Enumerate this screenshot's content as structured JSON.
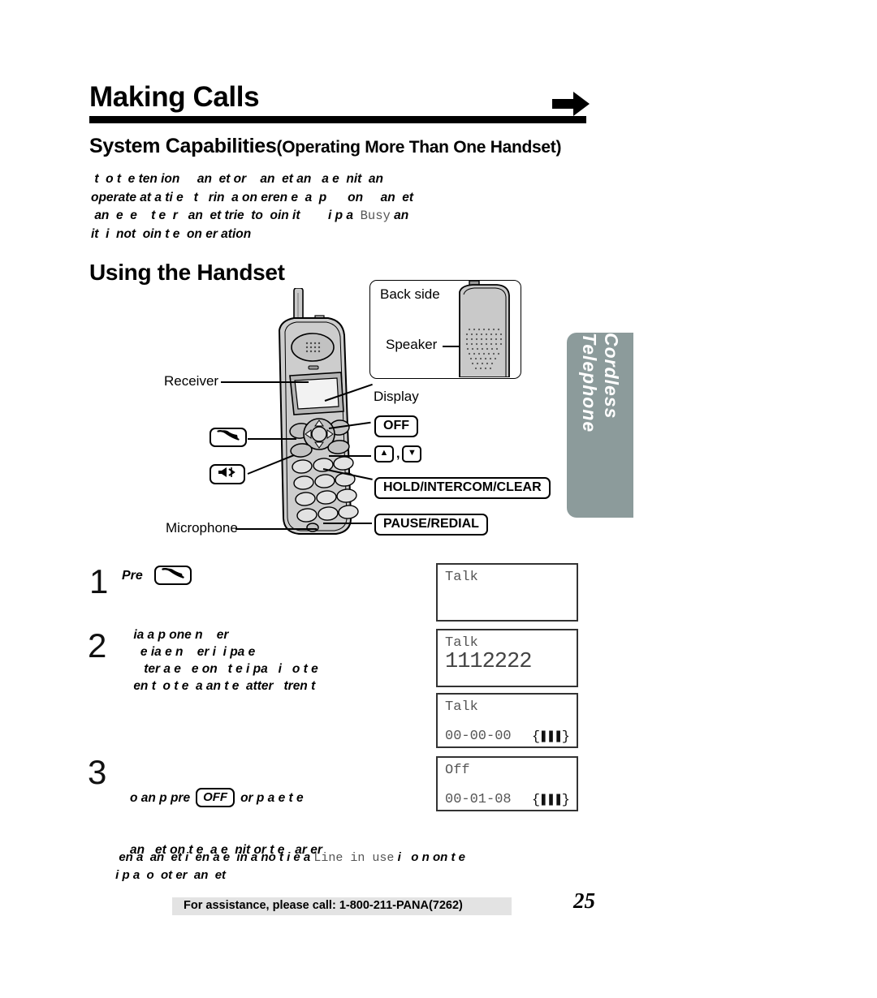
{
  "document": {
    "page_number": "25",
    "title": "Making Calls",
    "section_heading_main": "System Capabilities",
    "section_heading_sub": "(Operating More Than One Handset)",
    "intro_paragraph": " t  o t  e ten ion     an  et or    an  et an   a e  nit  an\noperate at a ti e   t   rin  a on eren e  a  p      on     an  et\n an  e  e    t e  r   an  et trie  to  oin it        i p a  ",
    "intro_mono_word": "Busy",
    "intro_paragraph_tail": " an\nit  i  not  oin t e  on er ation",
    "subsection_heading": "Using the Handset"
  },
  "diagram": {
    "backside_box_label": "Back side",
    "speaker_label": "Speaker",
    "receiver_label": "Receiver",
    "display_label": "Display",
    "microphone_label": "Microphone",
    "callouts": {
      "off_key": "OFF",
      "up_key": "▲",
      "down_key": "▼",
      "arrow_separator": ",",
      "hold_key": "HOLD/INTERCOM/CLEAR",
      "pause_key": "PAUSE/REDIAL",
      "talk_key_icon": "handset-icon",
      "speakerphone_key_icon": "speakerphone-icon"
    }
  },
  "side_tab": {
    "label": "Cordless Telephone",
    "color": "#8c9b9b"
  },
  "steps": [
    {
      "number": "1",
      "text": "Pre",
      "key_icon": "handset-icon"
    },
    {
      "number": "2",
      "text": " ia a p one n    er\n   e ia e n    er i  i pa e\n    ter a e   e on   t e i pa   i   o t e\n en t  o t e  a an t e  atter   tren t"
    },
    {
      "number": "3",
      "text_before_key": " o  an   p pre",
      "key_label": "OFF",
      "text_after_key": "or p a  e t e",
      "text_line2": "an   et on t e  a e  nit or t e   ar er"
    }
  ],
  "lcd_displays": [
    {
      "line1": "Talk",
      "line2": "",
      "big_number": "",
      "time": "",
      "battery": ""
    },
    {
      "line1": "Talk",
      "line2": "",
      "big_number": "1112222",
      "time": "",
      "battery": ""
    },
    {
      "line1": "Talk",
      "line2": "",
      "big_number": "",
      "time": "00-00-00",
      "battery": "{❚❚❚}"
    },
    {
      "line1": "Off",
      "line2": "",
      "big_number": "",
      "time": "00-01-08",
      "battery": "{❚❚❚}"
    }
  ],
  "note": {
    "text_before_mono": "  en a  an  et i  en a e  in a no t i e a ",
    "mono_text": "Line in use",
    "text_after_mono": " i   o n on t e\n i p a  o  ot er  an  et"
  },
  "footer": {
    "assistance_text": "For assistance, please call: 1-800-211-PANA(7262)",
    "page_number": "25"
  }
}
